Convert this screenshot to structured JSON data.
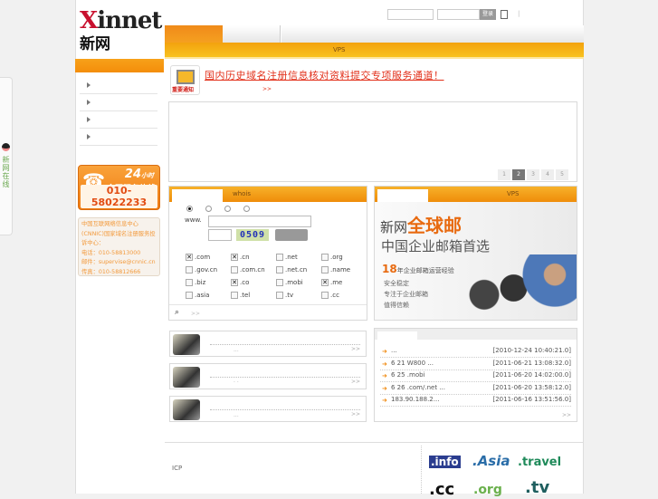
{
  "logo": {
    "text_red": "X",
    "text_black": "innet",
    "cn": "新网"
  },
  "left_float": {
    "label": "新网在线"
  },
  "hotline": {
    "hours": "24",
    "hours_unit": "小时",
    "label": "全国服务热线",
    "phone": "010-58022233"
  },
  "cnnic": {
    "lines": [
      "中国互联网络信息中心(CNNIC)国家域名注册服务投诉中心：",
      "电话：010-58813000",
      "邮件：supervise@cnnic.cn",
      "传真：010-58812666"
    ]
  },
  "header": {
    "login_label": "登录",
    "separator": "|"
  },
  "nav": {
    "band_label": "VPS"
  },
  "notice": {
    "icon_label": "重要通知",
    "text": "国内历史域名注册信息核对资料提交专项服务通道！",
    "more": ">>"
  },
  "banner": {
    "pages": [
      "1",
      "2",
      "3",
      "4",
      "5"
    ],
    "active_page": 2
  },
  "whois": {
    "tab_label": "whois",
    "www_label": "www.",
    "captcha": "0509",
    "more": ">>",
    "tlds": [
      {
        "l": ".com",
        "c": true
      },
      {
        "l": ".cn",
        "c": true
      },
      {
        "l": ".net",
        "c": false
      },
      {
        "l": ".org",
        "c": false
      },
      {
        "l": ".gov.cn",
        "c": false
      },
      {
        "l": ".com.cn",
        "c": false
      },
      {
        "l": ".net.cn",
        "c": false
      },
      {
        "l": ".name",
        "c": false
      },
      {
        "l": ".biz",
        "c": false
      },
      {
        "l": ".co",
        "c": true
      },
      {
        "l": ".mobi",
        "c": false
      },
      {
        "l": ".me",
        "c": true
      },
      {
        "l": ".asia",
        "c": false
      },
      {
        "l": ".tel",
        "c": false
      },
      {
        "l": ".tv",
        "c": false
      },
      {
        "l": ".cc",
        "c": false
      }
    ]
  },
  "mail": {
    "tab_label": "VPS",
    "brand": "新网",
    "product": "全球邮",
    "slogan": "中国企业邮箱首选",
    "years": "18",
    "years_text": "年企业邮箱运营经验",
    "points": [
      "安全稳定",
      "专注于企业邮箱",
      "值得信赖"
    ]
  },
  "products": [
    {
      "ell": "...",
      "more": ">>"
    },
    {
      "ell": "· ·",
      "more": ">>"
    },
    {
      "ell": "...",
      "more": ">>"
    }
  ],
  "news": {
    "items": [
      {
        "t": "...",
        "d": "[2010-12-24 10:40:21.0]"
      },
      {
        "t": "6 21    W800    ...",
        "d": "[2011-06-21 13:08:32.0]"
      },
      {
        "t": "6 25 .mobi",
        "d": "[2011-06-20 14:02:00.0]"
      },
      {
        "t": "6 26 .com/.net    ...",
        "d": "[2011-06-20 13:58:12.0]"
      },
      {
        "t": "      183.90.188.2...",
        "d": "[2011-06-16 13:51:56.0]"
      }
    ],
    "more": ">>"
  },
  "footer": {
    "icp": "ICP",
    "logos": [
      ".info",
      ".Asia",
      ".travel",
      ".cc",
      ".org",
      ".tv"
    ]
  }
}
